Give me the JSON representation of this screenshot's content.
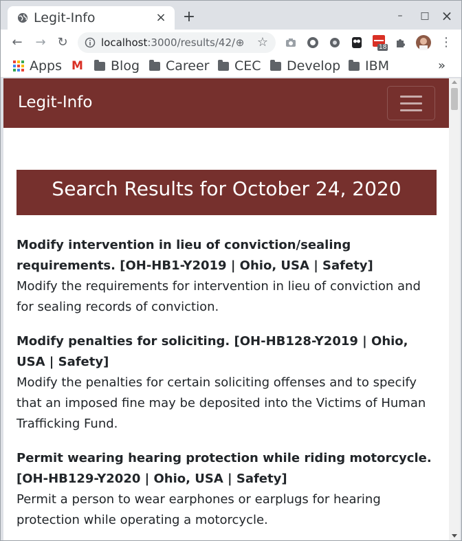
{
  "browser": {
    "tab": {
      "title": "Legit-Info",
      "close_icon": "×"
    },
    "new_tab_icon": "+",
    "window_controls": {
      "minimize": "–",
      "maximize": "□",
      "close": "×"
    },
    "toolbar": {
      "back_icon": "←",
      "forward_icon": "→",
      "reload_icon": "↻",
      "url_host": "localhost",
      "url_path": ":3000/results/42/",
      "zoom_icon": "⊕",
      "star_icon": "☆",
      "extension_badge": "18"
    },
    "bookmarks": [
      {
        "label": "Apps",
        "icon": "apps-grid-icon"
      },
      {
        "label": "",
        "icon": "gmail-icon"
      },
      {
        "label": "Blog",
        "icon": "folder-icon"
      },
      {
        "label": "Career",
        "icon": "folder-icon"
      },
      {
        "label": "CEC",
        "icon": "folder-icon"
      },
      {
        "label": "Develop",
        "icon": "folder-icon"
      },
      {
        "label": "IBM",
        "icon": "folder-icon"
      }
    ],
    "bookmarks_more": "»",
    "gmail_glyph": "M"
  },
  "page": {
    "brand": "Legit-Info",
    "heading": "Search Results for October 24, 2020",
    "results": [
      {
        "title": "Modify intervention in lieu of conviction/sealing requirements. [OH-HB1-Y2019 | Ohio, USA | Safety]",
        "description": "Modify the requirements for intervention in lieu of conviction and for sealing records of conviction."
      },
      {
        "title": "Modify penalties for soliciting. [OH-HB128-Y2019 | Ohio, USA | Safety]",
        "description": "Modify the penalties for certain soliciting offenses and to specify that an imposed fine may be deposited into the Victims of Human Trafficking Fund."
      },
      {
        "title": "Permit wearing hearing protection while riding motorcycle. [OH-HB129-Y2020 | Ohio, USA | Safety]",
        "description": "Permit a person to wear earphones or earplugs for hearing protection while operating a motorcycle."
      }
    ]
  },
  "colors": {
    "brand_maroon": "#76302d",
    "chrome_frame": "#dee1e6"
  }
}
